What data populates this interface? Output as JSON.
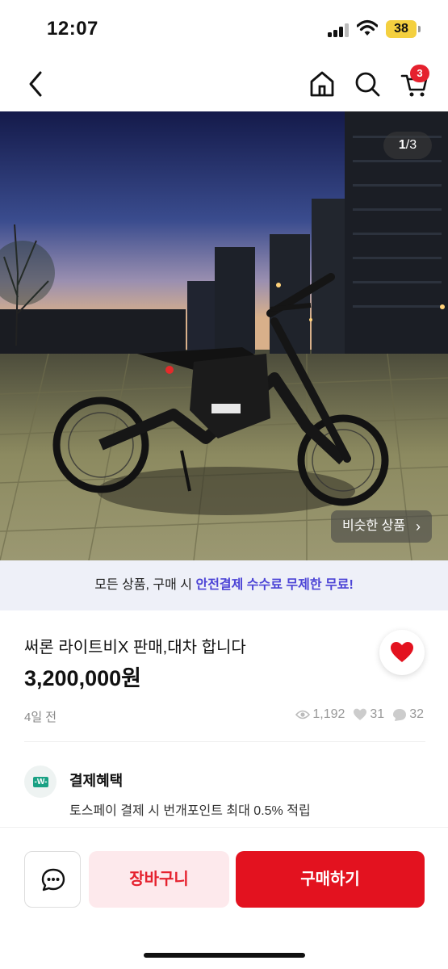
{
  "status_bar": {
    "time": "12:07",
    "battery": "38"
  },
  "nav": {
    "cart_count": "3"
  },
  "hero": {
    "page_current": "1",
    "page_total": "/3",
    "similar_label": "비슷한 상품",
    "similar_chevron": "›"
  },
  "promo": {
    "prefix": "모든 상품, 구매 시 ",
    "highlight": "안전결제 수수료 무제한 무료!"
  },
  "product": {
    "title": "써론 라이트비X 판매,대차 합니다",
    "price": "3,200,000원",
    "posted": "4일 전",
    "views": "1,192",
    "likes": "31",
    "chats": "32"
  },
  "benefit": {
    "icon_text": "-W-",
    "title": "결제혜택",
    "desc": "토스페이 결제 시 번개포인트 최대 0.5% 적립"
  },
  "actions": {
    "cart_label": "장바구니",
    "buy_label": "구매하기"
  },
  "colors": {
    "accent": "#e3121f",
    "promo_highlight": "#4c44d6",
    "benefit_green": "#1aa184"
  },
  "icons": [
    "back-icon",
    "home-icon",
    "search-icon",
    "cart-icon",
    "heart-icon",
    "eye-icon",
    "chat-icon"
  ]
}
